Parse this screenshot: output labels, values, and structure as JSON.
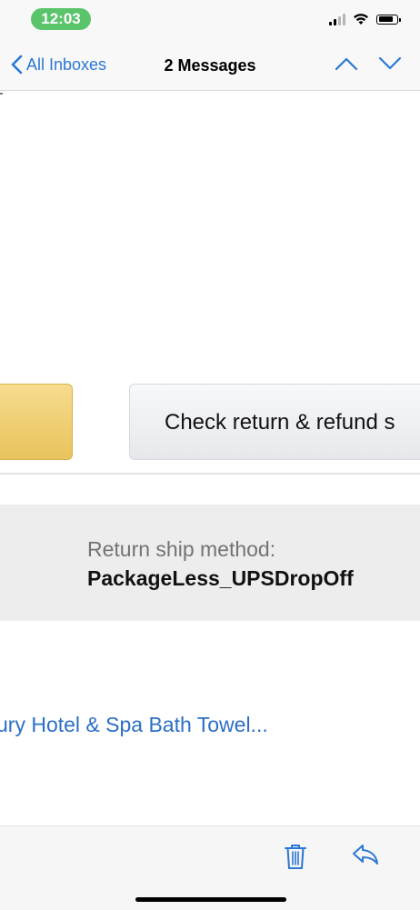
{
  "status_bar": {
    "time": "12:03",
    "icons": [
      "cellular-signal-icon",
      "wifi-icon",
      "battery-icon"
    ],
    "time_pill_color": "#5ac46a"
  },
  "nav": {
    "back_label": "All Inboxes",
    "title": "2 Messages",
    "icons": [
      "chevron-left-icon",
      "chevron-up-icon",
      "chevron-down-icon"
    ],
    "accent_color": "#2b77d4"
  },
  "email": {
    "check_return_button": "Check return & refund s",
    "return_ship_label": "Return ship method:",
    "return_ship_value": "PackageLess_UPSDropOff",
    "product_link": "ury Hotel & Spa Bath Towel..."
  },
  "toolbar": {
    "icons": [
      "trash-icon",
      "reply-icon"
    ]
  }
}
